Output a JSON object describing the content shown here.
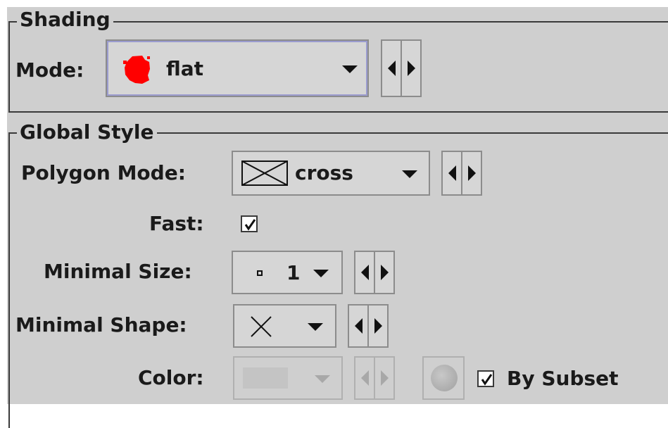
{
  "shading": {
    "legend": "Shading",
    "mode_label": "Mode:",
    "mode_value": "flat",
    "mode_icon": "red-blob-icon"
  },
  "global_style": {
    "legend": "Global Style",
    "polygon_mode_label": "Polygon Mode:",
    "polygon_mode_value": "cross",
    "polygon_mode_icon": "crossed-box-icon",
    "fast_label": "Fast:",
    "fast_checked": true,
    "minimal_size_label": "Minimal Size:",
    "minimal_size_value": "1",
    "minimal_size_icon": "dot-icon",
    "minimal_shape_label": "Minimal Shape:",
    "minimal_shape_icon": "x-shape-icon",
    "color_label": "Color:",
    "color_enabled": false,
    "color_icon": "color-wheel-icon",
    "by_subset_label": "By Subset",
    "by_subset_checked": true
  },
  "colors": {
    "panel_bg": "#cfcfcf",
    "accent_red": "#ff0000",
    "focus_ring": "#9b9ccf"
  }
}
